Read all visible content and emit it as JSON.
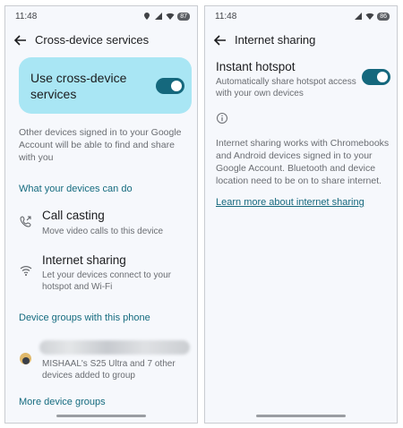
{
  "colors": {
    "accent": "#15687d",
    "card_bg": "#a9e6f4",
    "screen_bg": "#f6f8fc"
  },
  "left": {
    "status": {
      "time": "11:48",
      "battery": "87"
    },
    "title": "Cross-device services",
    "toggle_card": {
      "label": "Use cross-device services",
      "enabled": true
    },
    "description": "Other devices signed in to your Google Account will be able to find and share with you",
    "section1": "What your devices can do",
    "call_casting": {
      "title": "Call casting",
      "subtitle": "Move video calls to this device",
      "icon": "call-cast-icon"
    },
    "internet_sharing": {
      "title": "Internet sharing",
      "subtitle": "Let your devices connect to your hotspot and Wi-Fi",
      "icon": "wifi-icon"
    },
    "section2": "Device groups with this phone",
    "group_subtitle": "MISHAAL's S25 Ultra and 7 other devices added to group",
    "more_groups": "More device groups"
  },
  "right": {
    "status": {
      "time": "11:48",
      "battery": "86"
    },
    "title": "Internet sharing",
    "hotspot": {
      "title": "Instant hotspot",
      "subtitle": "Automatically share hotspot access with your own devices",
      "enabled": true
    },
    "info": "Internet sharing works with Chromebooks and Android devices signed in to your Google Account. Bluetooth and device location need to be on to share internet.",
    "learn_more": "Learn more about internet sharing"
  }
}
